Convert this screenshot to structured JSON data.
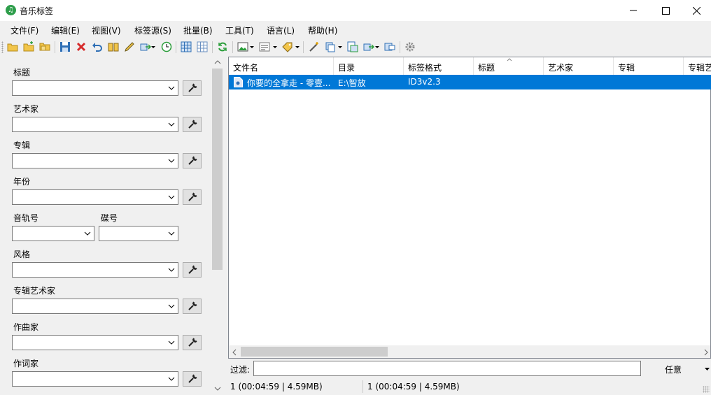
{
  "window": {
    "title": "音乐标签"
  },
  "menu": [
    "文件(F)",
    "编辑(E)",
    "视图(V)",
    "标签源(S)",
    "批量(B)",
    "工具(T)",
    "语言(L)",
    "帮助(H)"
  ],
  "fields": {
    "title": "标题",
    "artist": "艺术家",
    "album": "专辑",
    "year": "年份",
    "track": "音轨号",
    "disc": "碟号",
    "genre": "风格",
    "album_artist": "专辑艺术家",
    "composer": "作曲家",
    "lyricist": "作词家"
  },
  "columns": [
    "文件名",
    "目录",
    "标签格式",
    "标题",
    "艺术家",
    "专辑",
    "专辑艺"
  ],
  "rows": [
    {
      "filename": "你要的全拿走 - 零壹...",
      "directory": "E:\\智放",
      "tag_format": "ID3v2.3",
      "title": "",
      "artist": "",
      "album": ""
    }
  ],
  "filter": {
    "label": "过滤:",
    "value": "",
    "mode": "任意"
  },
  "status": {
    "left": "1 (00:04:59 | 4.59MB)",
    "right": "1 (00:04:59 | 4.59MB)"
  },
  "colors": {
    "selection": "#0078d7",
    "background": "#f0f0f0"
  }
}
